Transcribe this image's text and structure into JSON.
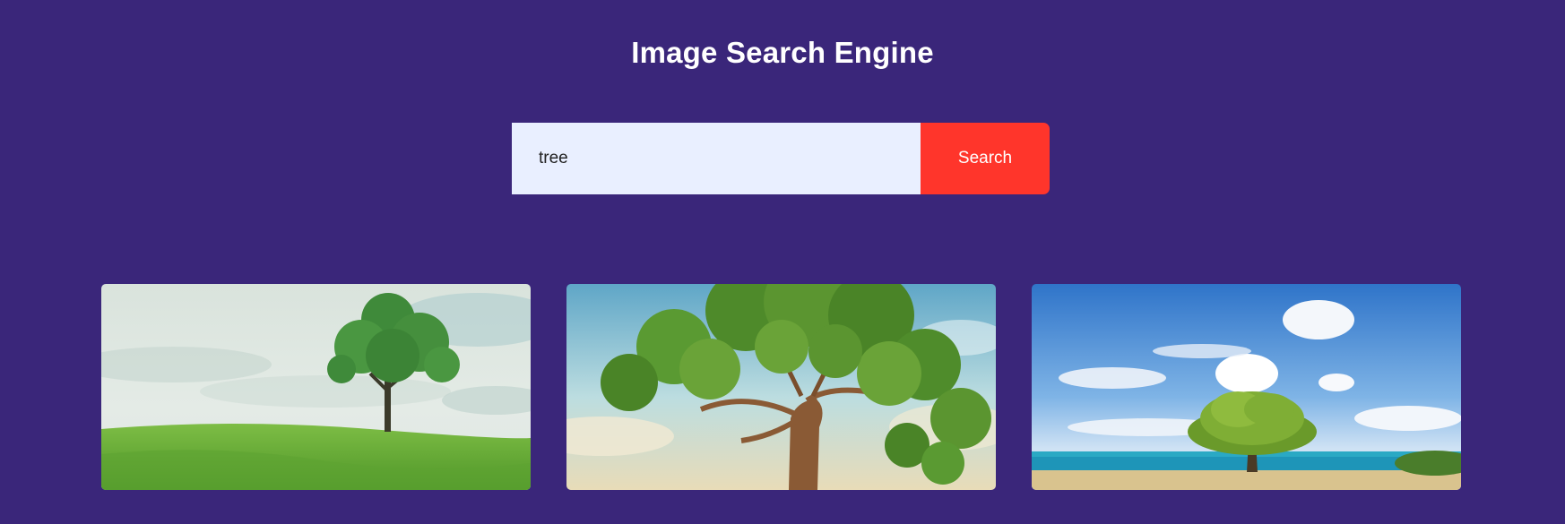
{
  "header": {
    "title": "Image Search Engine"
  },
  "search": {
    "value": "tree",
    "button_label": "Search"
  },
  "results": [
    {
      "subject": "lone tree on grassy hill under cloudy sky"
    },
    {
      "subject": "large tree canopy against blue sky"
    },
    {
      "subject": "tree on sandy beach by the ocean"
    }
  ],
  "colors": {
    "background": "#3a267a",
    "input_bg": "#e9efff",
    "button_bg": "#ff352b"
  }
}
